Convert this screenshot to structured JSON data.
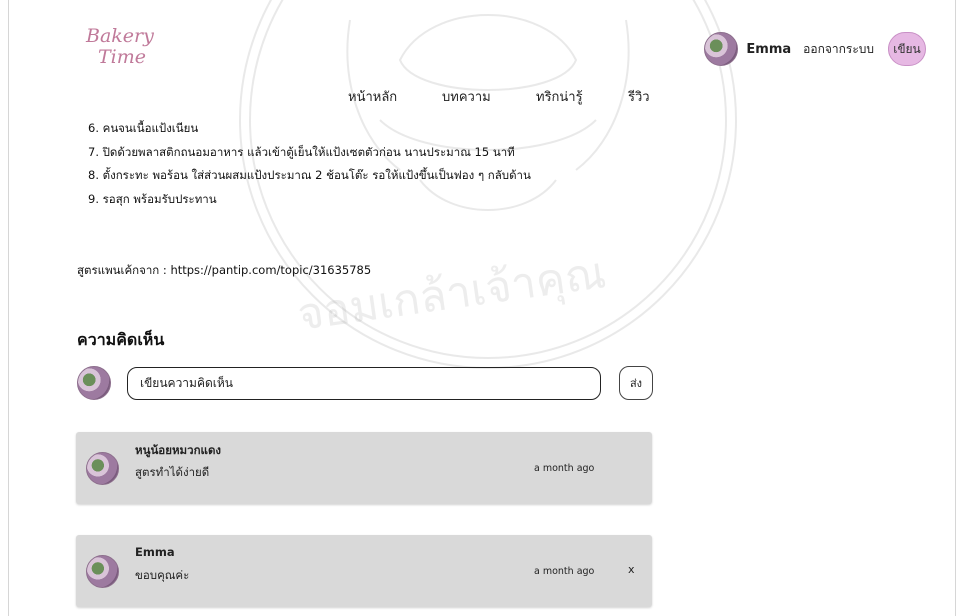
{
  "brand": {
    "line1": "Bakery",
    "line2": "Time"
  },
  "user": {
    "name": "Emma",
    "logout_label": "ออกจากระบบ",
    "write_label": "เขียน"
  },
  "nav": {
    "items": [
      {
        "label": "หน้าหลัก"
      },
      {
        "label": "บทความ"
      },
      {
        "label": "ทริกน่ารู้"
      },
      {
        "label": "รีวิว"
      }
    ]
  },
  "article": {
    "steps": [
      "6. คนจนเนื้อแป้งเนียน",
      "7. ปิดด้วยพลาสติกถนอมอาหาร แล้วเข้าตู้เย็นให้แป้งเซตตัวก่อน นานประมาณ 15 นาที",
      "8. ตั้งกระทะ พอร้อน ใส่ส่วนผสมแป้งประมาณ 2 ช้อนโต๊ะ รอให้แป้งขึ้นเป็นฟอง ๆ กลับด้าน",
      "9. รอสุก พร้อมรับประทาน"
    ],
    "source": "สูตรแพนเค้กจาก : https://pantip.com/topic/31635785"
  },
  "comments": {
    "title": "ความคิดเห็น",
    "input_placeholder": "เขียนความคิดเห็น",
    "send_label": "ส่ง",
    "items": [
      {
        "author": "หนูน้อยหมวกแดง",
        "text": "สูตรทำได้ง่ายดี",
        "time": "a month ago"
      },
      {
        "author": "Emma",
        "text": "ขอบคุณค่ะ",
        "time": "a month ago",
        "delete_label": "x"
      }
    ]
  }
}
